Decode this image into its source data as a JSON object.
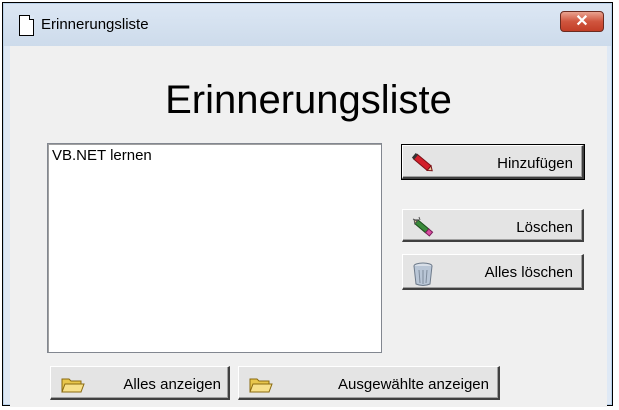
{
  "window": {
    "title": "Erinnerungsliste",
    "close_label": "✕"
  },
  "main": {
    "heading": "Erinnerungsliste",
    "list_items": [
      "VB.NET lernen"
    ]
  },
  "buttons": {
    "add": "Hinzufügen",
    "delete": "Löschen",
    "delete_all": "Alles löschen",
    "show_all": "Alles anzeigen",
    "show_selected": "Ausgewählte anzeigen"
  },
  "icons": {
    "add": "pencil-icon",
    "delete": "eraser-pencil-icon",
    "delete_all": "recycle-bin-icon",
    "show_all": "folder-icon",
    "show_selected": "folder-icon"
  },
  "colors": {
    "titlebar": "#dce7f4",
    "close_button": "#c9452f",
    "client": "#f0f0f0"
  }
}
